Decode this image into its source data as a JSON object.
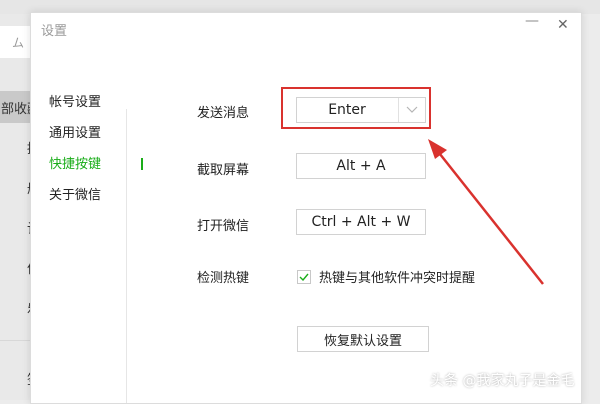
{
  "background_app": {
    "search_glyph": "ム",
    "items": [
      {
        "label": "部收藏",
        "selected": true
      },
      {
        "label": "接",
        "selected": false
      },
      {
        "label": "册",
        "selected": false
      },
      {
        "label": "记",
        "selected": false
      },
      {
        "label": "件",
        "selected": false
      },
      {
        "label": "乐",
        "selected": false
      },
      {
        "label": "签",
        "selected": false
      }
    ]
  },
  "window": {
    "title": "设置",
    "minimize_glyph": "—",
    "close_glyph": "✕"
  },
  "nav": {
    "items": [
      {
        "label": "帐号设置",
        "active": false
      },
      {
        "label": "通用设置",
        "active": false
      },
      {
        "label": "快捷按键",
        "active": true
      },
      {
        "label": "关于微信",
        "active": false
      }
    ]
  },
  "settings": {
    "send_message": {
      "label": "发送消息",
      "value": "Enter"
    },
    "screenshot": {
      "label": "截取屏幕",
      "value": "Alt + A"
    },
    "open_wechat": {
      "label": "打开微信",
      "value": "Ctrl + Alt + W"
    },
    "detect_hotkey": {
      "label": "检测热键",
      "checkbox_label": "热键与其他软件冲突时提醒",
      "checked": true
    },
    "restore_button": "恢复默认设置"
  },
  "watermark": "头条 @我家丸子是金毛",
  "colors": {
    "accent_green": "#1aad19",
    "annotation_red": "#d9322e"
  }
}
